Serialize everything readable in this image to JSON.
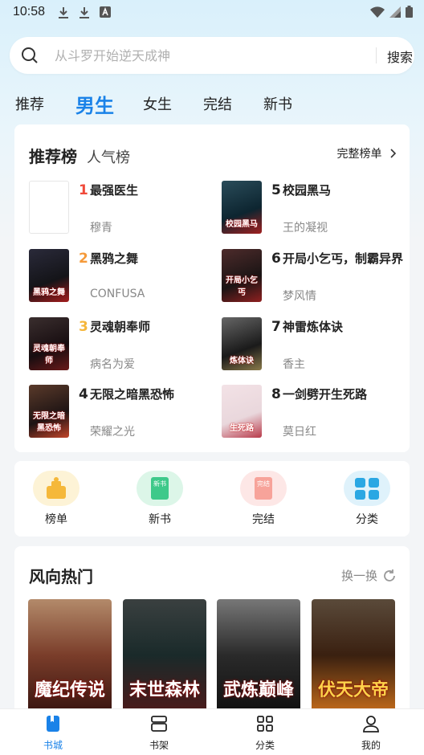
{
  "status_bar": {
    "time": "10:58"
  },
  "search": {
    "placeholder": "从斗罗开始逆天成神",
    "button": "搜索"
  },
  "tabs": [
    {
      "label": "推荐",
      "active": false
    },
    {
      "label": "男生",
      "active": true
    },
    {
      "label": "女生",
      "active": false
    },
    {
      "label": "完结",
      "active": false
    },
    {
      "label": "新书",
      "active": false
    }
  ],
  "ranking": {
    "title_active": "推荐榜",
    "title_other": "人气榜",
    "more": "完整榜单",
    "books": [
      {
        "rank": "1",
        "rank_color": "#f04a3a",
        "title": "最强医生",
        "author": "穆青",
        "cover_text": ""
      },
      {
        "rank": "2",
        "rank_color": "#f59a3a",
        "title": "黑鸦之舞",
        "author": "CONFUSA",
        "cover_text": "黑鸦之舞"
      },
      {
        "rank": "3",
        "rank_color": "#f5b63a",
        "title": "灵魂朝奉师",
        "author": "病名为爱",
        "cover_text": "灵魂朝奉师"
      },
      {
        "rank": "4",
        "rank_color": "#222222",
        "title": "无限之暗黑恐怖",
        "author": "荣耀之光",
        "cover_text": "无限之暗黑恐怖"
      },
      {
        "rank": "5",
        "rank_color": "#222222",
        "title": "校园黑马",
        "author": "王的凝视",
        "cover_text": "校园黑马"
      },
      {
        "rank": "6",
        "rank_color": "#222222",
        "title": "开局小乞丐，制霸异界",
        "author": "梦风情",
        "cover_text": "开局小乞丐"
      },
      {
        "rank": "7",
        "rank_color": "#222222",
        "title": "神雷炼体诀",
        "author": "香主",
        "cover_text": "炼体诀"
      },
      {
        "rank": "8",
        "rank_color": "#222222",
        "title": "一剑劈开生死路",
        "author": "莫日红",
        "cover_text": "生死路"
      }
    ]
  },
  "shortcuts": [
    {
      "label": "榜单",
      "icon": "trophy-icon",
      "bg": "#fdf3d6",
      "fg": "#f5b83a"
    },
    {
      "label": "新书",
      "icon": "new-book-icon",
      "bg": "#dcf6e8",
      "fg": "#3ec98a",
      "badge": "新书"
    },
    {
      "label": "完结",
      "icon": "finished-book-icon",
      "bg": "#fde7e6",
      "fg": "#f7a39a",
      "badge": "完结"
    },
    {
      "label": "分类",
      "icon": "category-grid-icon",
      "bg": "#dff2fb",
      "fg": "#2aa7e3"
    }
  ],
  "hot": {
    "title": "风向热门",
    "refresh": "换一换",
    "books": [
      {
        "cover_text": "魔纪传说"
      },
      {
        "cover_text": "末世森林"
      },
      {
        "cover_text": "武炼巅峰"
      },
      {
        "cover_text": "伏天大帝"
      }
    ]
  },
  "bottom_nav": [
    {
      "label": "书城",
      "icon": "bookstore-icon",
      "active": true
    },
    {
      "label": "书架",
      "icon": "bookshelf-icon",
      "active": false
    },
    {
      "label": "分类",
      "icon": "category-icon",
      "active": false
    },
    {
      "label": "我的",
      "icon": "profile-icon",
      "active": false
    }
  ],
  "colors": {
    "accent": "#1a82e8"
  }
}
